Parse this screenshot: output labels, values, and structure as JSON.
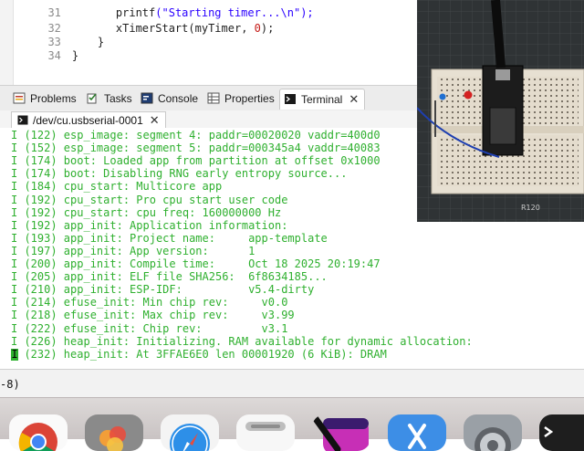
{
  "editor": {
    "lines": [
      {
        "num": "31",
        "fn": "printf",
        "str": "(\"Starting timer...\\n\");"
      },
      {
        "num": "32",
        "fn": "xTimerStart",
        "args": "(myTimer, ",
        "arg_num": "0",
        "tail": ");"
      },
      {
        "num": "33",
        "text": "}"
      },
      {
        "num": "34",
        "text": "}"
      }
    ]
  },
  "views": {
    "tabs": [
      {
        "label": "Problems",
        "icon": "problems-icon"
      },
      {
        "label": "Tasks",
        "icon": "tasks-icon"
      },
      {
        "label": "Console",
        "icon": "console-icon"
      },
      {
        "label": "Properties",
        "icon": "properties-icon"
      },
      {
        "label": "Terminal",
        "icon": "terminal-icon",
        "active": true
      }
    ],
    "close_glyph": "✕"
  },
  "session": {
    "label": "/dev/cu.usbserial-0001",
    "close_glyph": "✕"
  },
  "terminal": {
    "color": "#2fb02f",
    "lines": [
      "I (122) esp_image: segment 4: paddr=00020020 vaddr=400d0",
      "I (152) esp_image: segment 5: paddr=000345a4 vaddr=40083",
      "I (174) boot: Loaded app from partition at offset 0x1000",
      "I (174) boot: Disabling RNG early entropy source...",
      "I (184) cpu_start: Multicore app",
      "I (192) cpu_start: Pro cpu start user code",
      "I (192) cpu_start: cpu freq: 160000000 Hz",
      "I (192) app_init: Application information:",
      "I (193) app_init: Project name:     app-template",
      "I (197) app_init: App version:      1",
      "I (200) app_init: Compile time:     Oct 18 2025 20:19:47",
      "I (205) app_init: ELF file SHA256:  6f8634185...",
      "I (210) app_init: ESP-IDF:          v5.4-dirty",
      "I (214) efuse_init: Min chip rev:     v0.0",
      "I (218) efuse_init: Max chip rev:     v3.99",
      "I (222) efuse_init: Chip rev:         v3.1",
      "I (226) heap_init: Initializing. RAM available for dynamic allocation:",
      "I (232) heap_init: At 3FFAE6E0 len 00001920 (6 KiB): DRAM"
    ],
    "cursor_char": "I"
  },
  "status": {
    "text": "-8)"
  },
  "dock": {
    "apps": [
      {
        "name": "chrome-icon"
      },
      {
        "name": "photos-icon"
      },
      {
        "name": "safari-icon"
      },
      {
        "name": "notes-icon"
      },
      {
        "name": "music-icon"
      },
      {
        "name": "xcode-icon"
      },
      {
        "name": "system-settings-icon"
      },
      {
        "name": "terminal-app-icon"
      }
    ]
  },
  "camera": {
    "board_label": "R120"
  }
}
